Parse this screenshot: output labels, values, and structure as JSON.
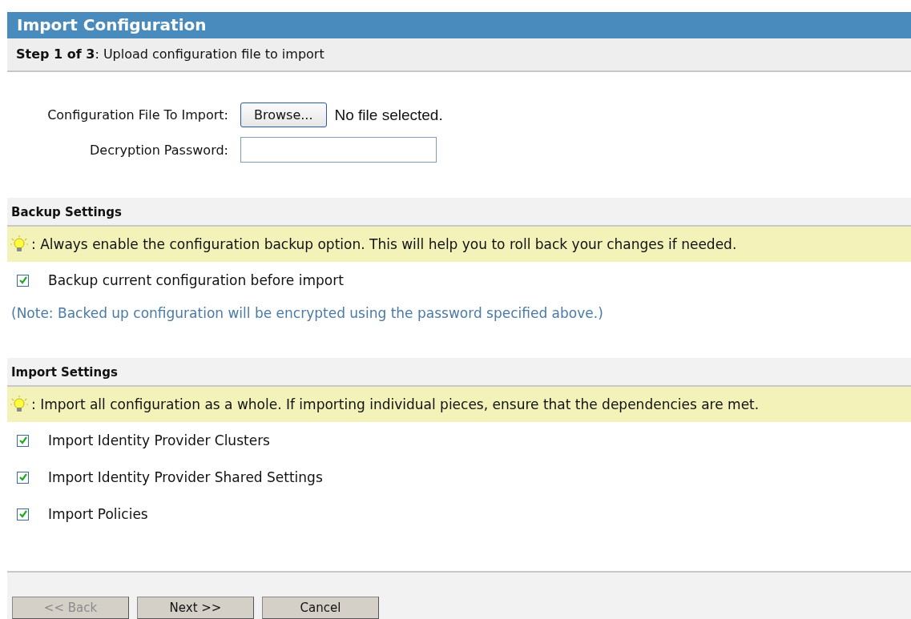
{
  "window": {
    "title": "Import Configuration"
  },
  "step": {
    "text": "**Step 1 of 3**: Upload configuration file to import"
  },
  "form": {
    "file_label": "Configuration File To Import:",
    "browse_button": "Browse...",
    "file_status": "No file selected.",
    "password_label": "Decryption Password:"
  },
  "sections": [
    {
      "title": "Backup Settings",
      "tip": ": Always enable the configuration backup option. This will help you to roll back your changes if needed.",
      "options": [
        {
          "label": "Backup current configuration before import",
          "checked": true
        }
      ],
      "note": "(Note: Backed up configuration will be encrypted using the password specified above.)"
    },
    {
      "title": "Import Settings",
      "tip": ": Import all configuration as a whole. If importing individual pieces, ensure that the dependencies are met.",
      "options": [
        {
          "label": "Import Identity Provider Clusters",
          "checked": true
        },
        {
          "label": "Import Identity Provider Shared Settings",
          "checked": true
        },
        {
          "label": "Import Policies",
          "checked": true
        }
      ]
    }
  ],
  "buttons": [
    {
      "label": "<< Back",
      "disabled": true
    },
    {
      "label": "Next >>",
      "disabled": false
    },
    {
      "label": "Cancel",
      "disabled": false
    }
  ]
}
